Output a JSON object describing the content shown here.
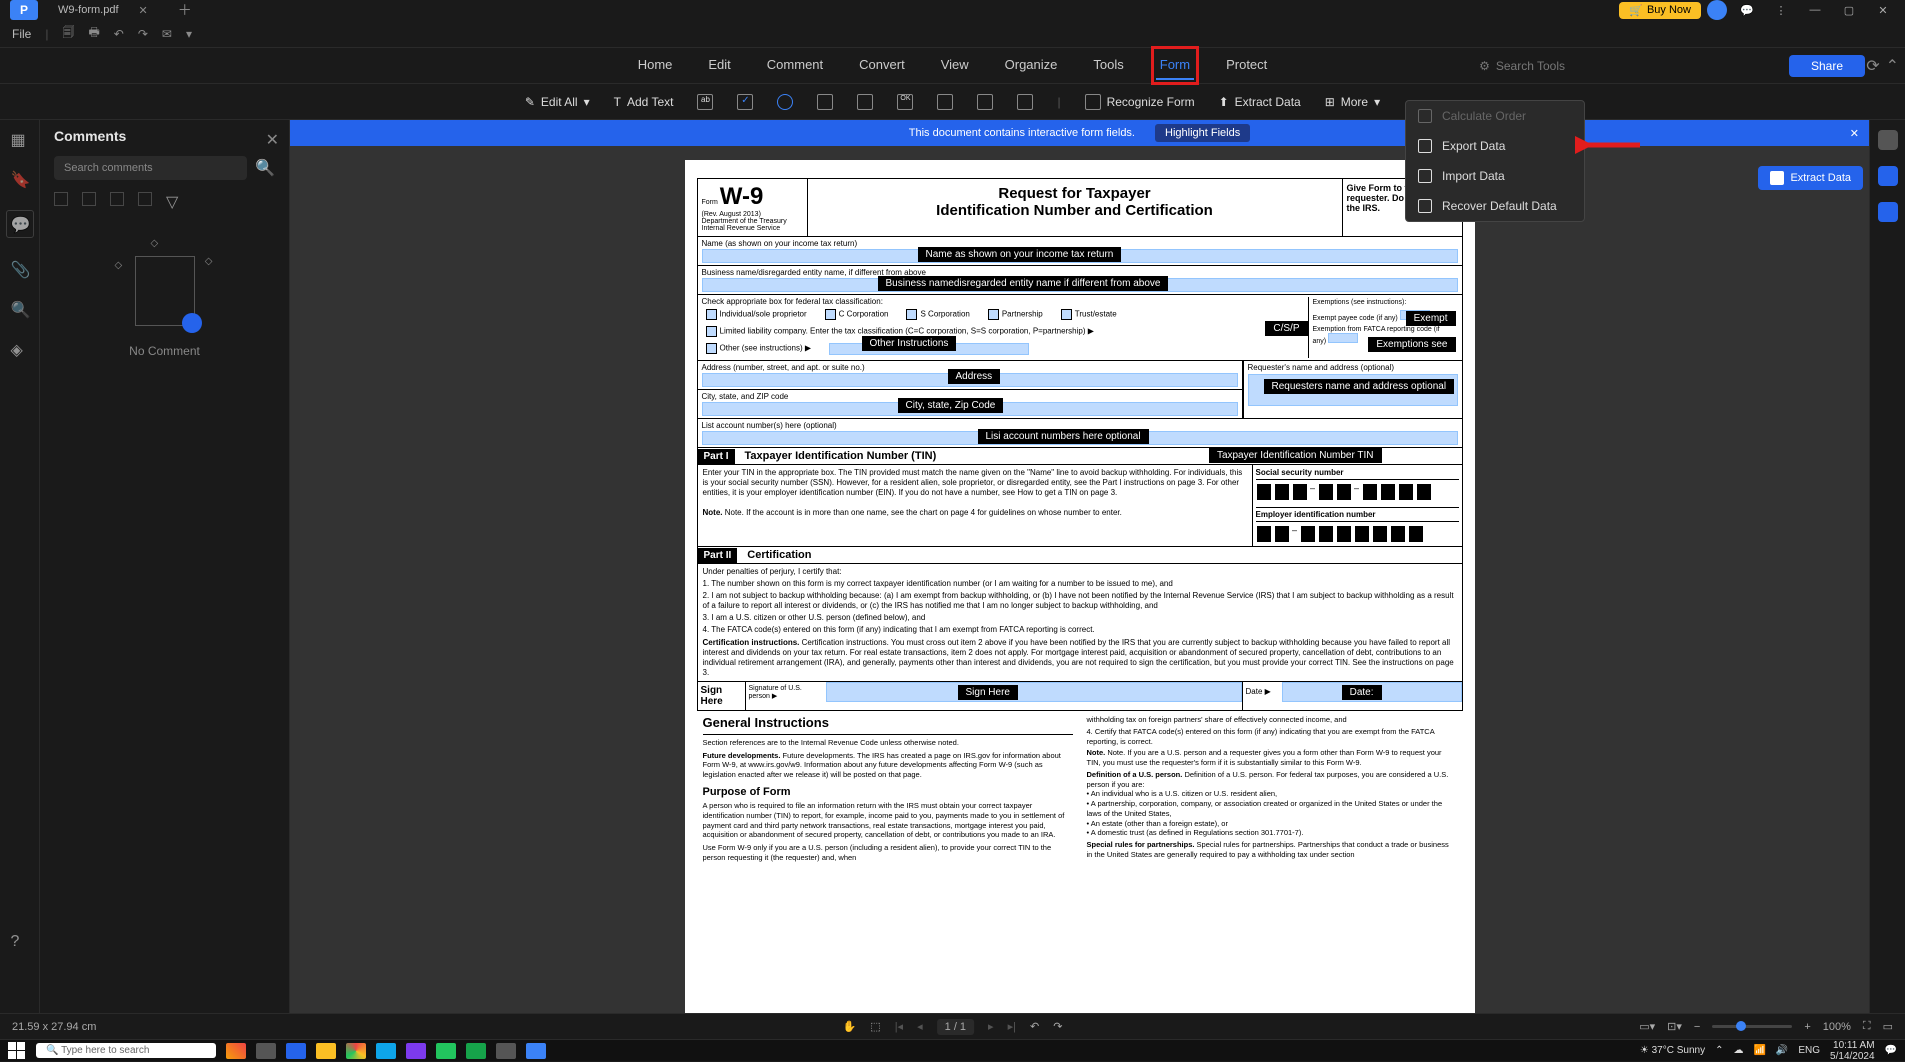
{
  "titlebar": {
    "logo": "P",
    "tab_name": "W9-form.pdf",
    "buy": "Buy Now"
  },
  "quickbar": {
    "file": "File"
  },
  "ribbon": {
    "tabs": [
      "Home",
      "Edit",
      "Comment",
      "Convert",
      "View",
      "Organize",
      "Tools",
      "Form",
      "Protect"
    ],
    "active": "Form",
    "search_ph": "Search Tools",
    "share": "Share"
  },
  "toolbar": {
    "edit_all": "Edit All",
    "add_text": "Add Text",
    "recognize": "Recognize Form",
    "extract": "Extract Data",
    "more": "More"
  },
  "comments": {
    "title": "Comments",
    "search_ph": "Search comments",
    "empty": "No Comment"
  },
  "banner": {
    "msg": "This document contains interactive form fields.",
    "hl": "Highlight Fields"
  },
  "extract_btn": "Extract Data",
  "moremenu": {
    "calc": "Calculate Order",
    "export": "Export Data",
    "import": "Import Data",
    "recover": "Recover Default Data"
  },
  "form": {
    "w9": "W-9",
    "form_label": "Form",
    "rev": "(Rev. August 2013)",
    "dept": "Department of the Treasury\nInternal Revenue Service",
    "title1": "Request for Taxpayer",
    "title2": "Identification Number and Certification",
    "give": "Give Form to the requester. Do not send to the IRS.",
    "name_lbl": "Name (as shown on your income tax return)",
    "name_tip": "Name as shown on your income tax return",
    "biz_lbl": "Business name/disregarded entity name, if different from above",
    "biz_tip": "Business namedisregarded entity name if different from above",
    "check_lbl": "Check appropriate box for federal tax classification:",
    "cb1": "Individual/sole proprietor",
    "cb2": "C Corporation",
    "cb3": "S Corporation",
    "cb4": "Partnership",
    "cb5": "Trust/estate",
    "csp": "C/S/P",
    "llc": "Limited liability company. Enter the tax classification (C=C corporation, S=S corporation, P=partnership) ▶",
    "other_lbl": "Other (see instructions) ▶",
    "other_tip": "Other Instructions",
    "exempt_hdr": "Exemptions (see instructions):",
    "exempt_payee": "Exempt payee code (if any)",
    "exempt_tip": "Exempt",
    "fatca": "Exemption from FATCA reporting code (if any)",
    "fatca_tip": "Exemptions see",
    "addr_lbl": "Address (number, street, and apt. or suite no.)",
    "addr_tip": "Address",
    "req_lbl": "Requester's name and address (optional)",
    "req_tip": "Requesters name and address optional",
    "city_lbl": "City, state, and ZIP code",
    "city_tip": "City, state, Zip Code",
    "acct_lbl": "List account number(s) here (optional)",
    "acct_tip": "Lisi account numbers here optional",
    "part1": "Part I",
    "part1_title": "Taxpayer Identification Number (TIN)",
    "tin_tip": "Taxpayer Identification Number TIN",
    "tin_txt": "Enter your TIN in the appropriate box. The TIN provided must match the name given on the \"Name\" line to avoid backup withholding. For individuals, this is your social security number (SSN). However, for a resident alien, sole proprietor, or disregarded entity, see the Part I instructions on page 3. For other entities, it is your employer identification number (EIN). If you do not have a number, see How to get a TIN on page 3.",
    "tin_note": "Note. If the account is in more than one name, see the chart on page 4 for guidelines on whose number to enter.",
    "ssn_lbl": "Social security number",
    "ein_lbl": "Employer identification number",
    "part2": "Part II",
    "part2_title": "Certification",
    "cert_intro": "Under penalties of perjury, I certify that:",
    "cert1": "1.  The number shown on this form is my correct taxpayer identification number (or I am waiting for a number to be issued to me), and",
    "cert2": "2.  I am not subject to backup withholding because: (a) I am exempt from backup withholding, or (b) I have not been notified by the Internal Revenue Service (IRS) that I am subject to backup withholding as a result of a failure to report all interest or dividends, or (c) the IRS has notified me that I am no longer subject to backup withholding, and",
    "cert3": "3.  I am a U.S. citizen or other U.S. person (defined below), and",
    "cert4": "4.  The FATCA code(s) entered on this form (if any) indicating that I am exempt from FATCA reporting is correct.",
    "cert_instr": "Certification instructions. You must cross out item 2 above if you have been notified by the IRS that you are currently subject to backup withholding because you have failed to report all interest and dividends on your tax return. For real estate transactions, item 2 does not apply. For mortgage interest paid, acquisition or abandonment of secured property, cancellation of debt, contributions to an individual retirement arrangement (IRA), and generally, payments other than interest and dividends, you are not required to sign the certification, but you must provide your correct TIN. See the instructions on page 3.",
    "sign": "Sign Here",
    "sig_of": "Signature of U.S. person ▶",
    "sign_tip": "Sign Here",
    "date_lbl": "Date ▶",
    "date_tip": "Date:",
    "gi": "General Instructions",
    "gi_ref": "Section references are to the Internal Revenue Code unless otherwise noted.",
    "gi_future": "Future developments. The IRS has created a page on IRS.gov for information about Form W-9, at www.irs.gov/w9. Information about any future developments affecting Form W-9 (such as legislation enacted after we release it) will be posted on that page.",
    "purpose": "Purpose of Form",
    "purpose_txt": "A person who is required to file an information return with the IRS must obtain your correct taxpayer identification number (TIN) to report, for example, income paid to you, payments made to you in settlement of payment card and third party network transactions, real estate transactions, mortgage interest you paid, acquisition or abandonment of secured property, cancellation of debt, or contributions you made to an IRA.",
    "purpose_txt2": "Use Form W-9 only if you are a U.S. person (including a resident alien), to provide your correct TIN to the person requesting it (the requester) and, when",
    "col2a": "withholding tax on foreign partners' share of effectively connected income, and",
    "col2b": "4. Certify that FATCA code(s) entered on this form (if any) indicating that you are exempt from the FATCA reporting, is correct.",
    "col2c": "Note. If you are a U.S. person and a requester gives you a form other than Form W-9 to request your TIN, you must use the requester's form if it is substantially similar to this Form W-9.",
    "col2d": "Definition of a U.S. person. For federal tax purposes, you are considered a U.S. person if you are:",
    "col2e": "• An individual who is a U.S. citizen or U.S. resident alien,",
    "col2f": "• A partnership, corporation, company, or association created or organized in the United States or under the laws of the United States,",
    "col2g": "• An estate (other than a foreign estate), or",
    "col2h": "• A domestic trust (as defined in Regulations section 301.7701-7).",
    "col2i": "Special rules for partnerships. Partnerships that conduct a trade or business in the United States are generally required to pay a withholding tax under section"
  },
  "status": {
    "dim": "21.59 x 27.94 cm",
    "page": "1",
    "pages": "/ 1",
    "zoom": "100%"
  },
  "taskbar": {
    "search": "Type here to search",
    "weather": "37°C  Sunny",
    "lang": "ENG",
    "time": "10:11 AM",
    "date": "5/14/2024"
  }
}
